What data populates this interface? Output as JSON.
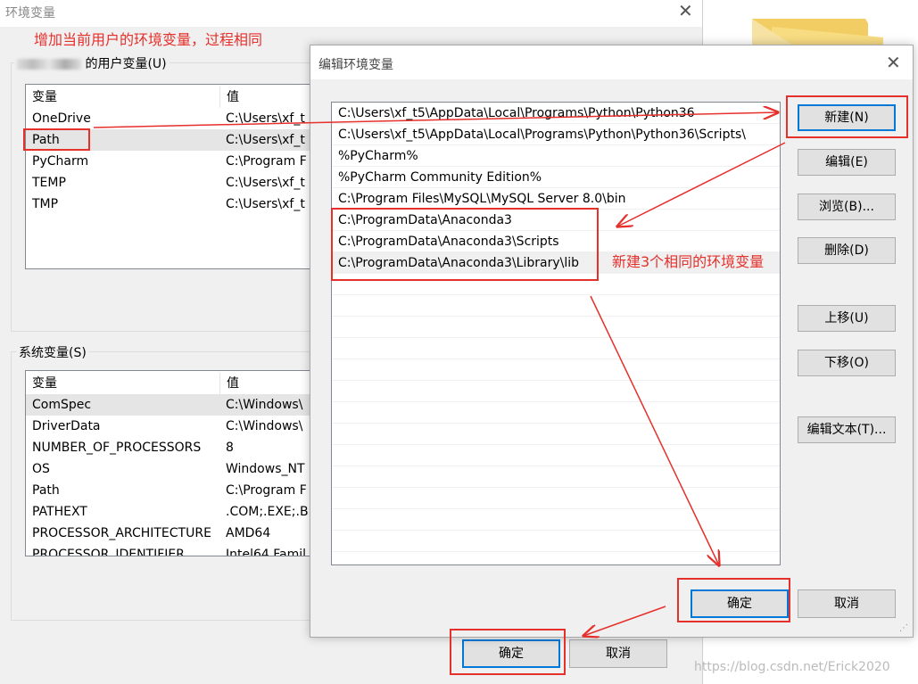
{
  "back_window": {
    "title": "环境变量",
    "user_group_label": "的用户变量(U)",
    "user_columns": [
      "变量",
      "值"
    ],
    "user_rows": [
      {
        "name": "OneDrive",
        "value": "C:\\Users\\xf_t"
      },
      {
        "name": "Path",
        "value": "C:\\Users\\xf_t",
        "selected": true
      },
      {
        "name": "PyCharm",
        "value": "C:\\Program F"
      },
      {
        "name": "TEMP",
        "value": "C:\\Users\\xf_t"
      },
      {
        "name": "TMP",
        "value": "C:\\Users\\xf_t"
      }
    ],
    "system_group_label": "系统变量(S)",
    "system_columns": [
      "变量",
      "值"
    ],
    "system_rows": [
      {
        "name": "ComSpec",
        "value": "C:\\Windows\\",
        "selected": true
      },
      {
        "name": "DriverData",
        "value": "C:\\Windows\\"
      },
      {
        "name": "NUMBER_OF_PROCESSORS",
        "value": "8"
      },
      {
        "name": "OS",
        "value": "Windows_NT"
      },
      {
        "name": "Path",
        "value": "C:\\Program F"
      },
      {
        "name": "PATHEXT",
        "value": ".COM;.EXE;.B"
      },
      {
        "name": "PROCESSOR_ARCHITECTURE",
        "value": "AMD64"
      },
      {
        "name": "PROCESSOR_IDENTIFIER",
        "value": "Intel64 Famil"
      }
    ],
    "ok_label": "确定",
    "cancel_label": "取消"
  },
  "edit_dialog": {
    "title": "编辑环境变量",
    "paths": [
      "C:\\Users\\xf_t5\\AppData\\Local\\Programs\\Python\\Python36",
      "C:\\Users\\xf_t5\\AppData\\Local\\Programs\\Python\\Python36\\Scripts\\",
      "%PyCharm%",
      "%PyCharm Community Edition%",
      "C:\\Program Files\\MySQL\\MySQL Server 8.0\\bin",
      "C:\\ProgramData\\Anaconda3",
      "C:\\ProgramData\\Anaconda3\\Scripts",
      "C:\\ProgramData\\Anaconda3\\Library\\lib"
    ],
    "selected_index": 7,
    "buttons": {
      "new": "新建(N)",
      "edit": "编辑(E)",
      "browse": "浏览(B)...",
      "delete": "删除(D)",
      "move_up": "上移(U)",
      "move_down": "下移(O)",
      "edit_text": "编辑文本(T)...",
      "ok": "确定",
      "cancel": "取消"
    }
  },
  "annotations": {
    "top_note": "增加当前用户的环境变量，过程相同",
    "middle_note": "新建3个相同的环境变量",
    "color": "#e5302b"
  },
  "watermark": "https://blog.csdn.net/Erick2020"
}
